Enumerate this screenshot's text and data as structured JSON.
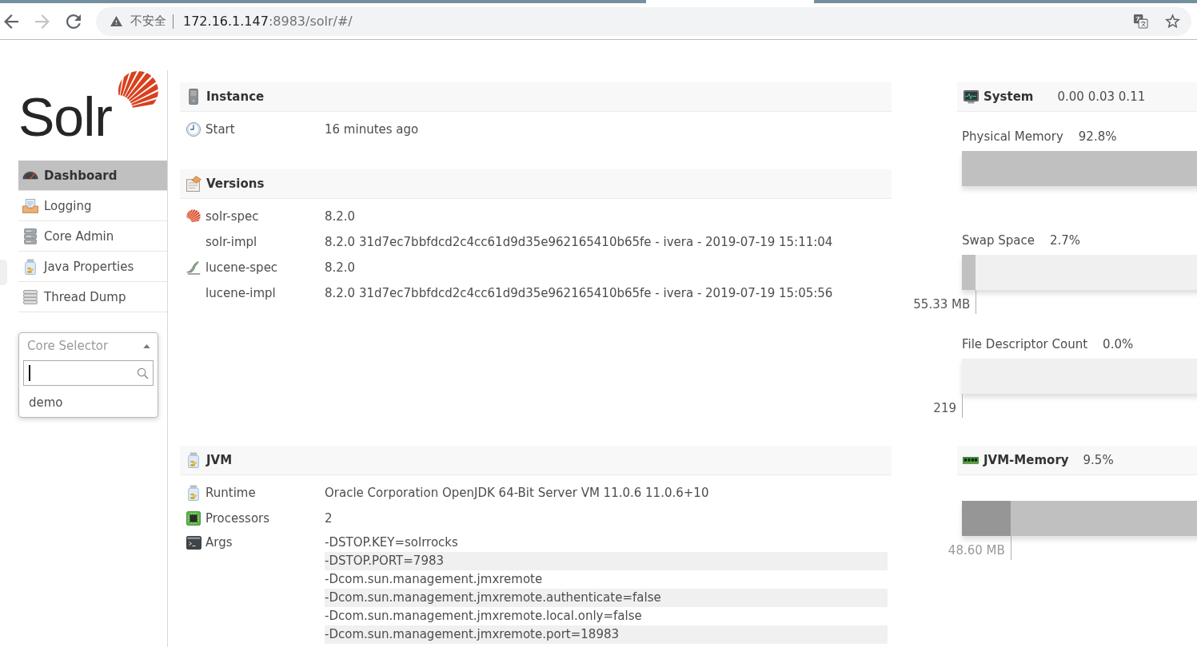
{
  "toolbar": {
    "buttons": [
      {
        "kind": "back",
        "disabled": false
      },
      {
        "kind": "forward",
        "disabled": true
      },
      {
        "kind": "reload",
        "disabled": false
      }
    ],
    "address_bar": {
      "security_label": "不安全",
      "host": "172.16.1.147",
      "path": ":8983/solr/#/"
    },
    "actions": [
      {
        "kind": "translate"
      },
      {
        "kind": "star"
      }
    ]
  },
  "logo": {
    "text": "Solr"
  },
  "sidebar": {
    "items": [
      {
        "label": "Dashboard",
        "selected": true
      },
      {
        "label": "Logging",
        "selected": false
      },
      {
        "label": "Core Admin",
        "selected": false
      },
      {
        "label": "Java Properties",
        "selected": false
      },
      {
        "label": "Thread Dump",
        "selected": false
      }
    ]
  },
  "core_selector": {
    "placeholder": "Core Selector",
    "expanded": true,
    "options": [
      "demo"
    ]
  },
  "sections": [
    {
      "title": "Instance",
      "rows": [
        {
          "label": "Start",
          "value": "16 minutes ago"
        }
      ]
    },
    {
      "title": "Versions",
      "rows": [
        {
          "label": "solr-spec",
          "value": "8.2.0"
        },
        {
          "label": "solr-impl",
          "value": "8.2.0 31d7ec7bbfdcd2c4cc61d9d35e962165410b65fe - ivera - 2019-07-19 15:11:04"
        },
        {
          "label": "lucene-spec",
          "value": "8.2.0"
        },
        {
          "label": "lucene-impl",
          "value": "8.2.0 31d7ec7bbfdcd2c4cc61d9d35e962165410b65fe - ivera - 2019-07-19 15:05:56"
        }
      ]
    }
  ],
  "system": {
    "title": "System",
    "load": "0.00 0.03 0.11",
    "meters": [
      {
        "label": "Physical Memory",
        "percent": "92.8%",
        "level": 0.928
      },
      {
        "label": "Swap Space",
        "percent": "2.7%",
        "level": 0.027,
        "reading": "55.33 MB"
      },
      {
        "label": "File Descriptor Count",
        "percent": "0.0%",
        "level": 0,
        "reading": "219"
      }
    ]
  },
  "jvm": {
    "title": "JVM",
    "rows": [
      {
        "kind": "field",
        "label": "Runtime",
        "value": "Oracle Corporation OpenJDK 64-Bit Server VM 11.0.6 11.0.6+10"
      },
      {
        "kind": "field",
        "label": "Processors",
        "value": "2"
      },
      {
        "kind": "list",
        "label": "Args",
        "values": [
          "-DSTOP.KEY=solrrocks",
          "-DSTOP.PORT=7983",
          "-Dcom.sun.management.jmxremote",
          "-Dcom.sun.management.jmxremote.authenticate=false",
          "-Dcom.sun.management.jmxremote.local.only=false",
          "-Dcom.sun.management.jmxremote.port=18983"
        ]
      }
    ]
  },
  "jvm_memory": {
    "title": "JVM-Memory",
    "percent": "9.5%",
    "level": 0.095,
    "reading": "48.60 MB"
  }
}
